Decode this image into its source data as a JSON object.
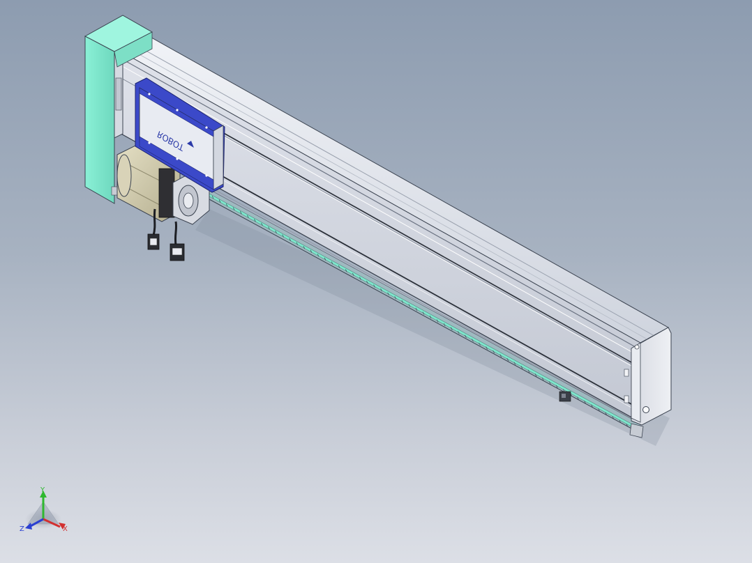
{
  "model_view": {
    "carriage_logo_text": "ROBOT",
    "colors": {
      "background_top": "#8d9cb0",
      "background_bottom": "#dcdfe6",
      "housing_light": "#e3e6ee",
      "housing_mid": "#cfd3dd",
      "end_cap_teal": "#7ee6cc",
      "carriage_blue": "#3b49c9",
      "motor_tan": "#cfc8a8"
    }
  },
  "triad": {
    "x_label": "X",
    "y_label": "Y",
    "z_label": "Z",
    "x_color": "#d23030",
    "y_color": "#2fb82f",
    "z_color": "#2a3fd1"
  }
}
